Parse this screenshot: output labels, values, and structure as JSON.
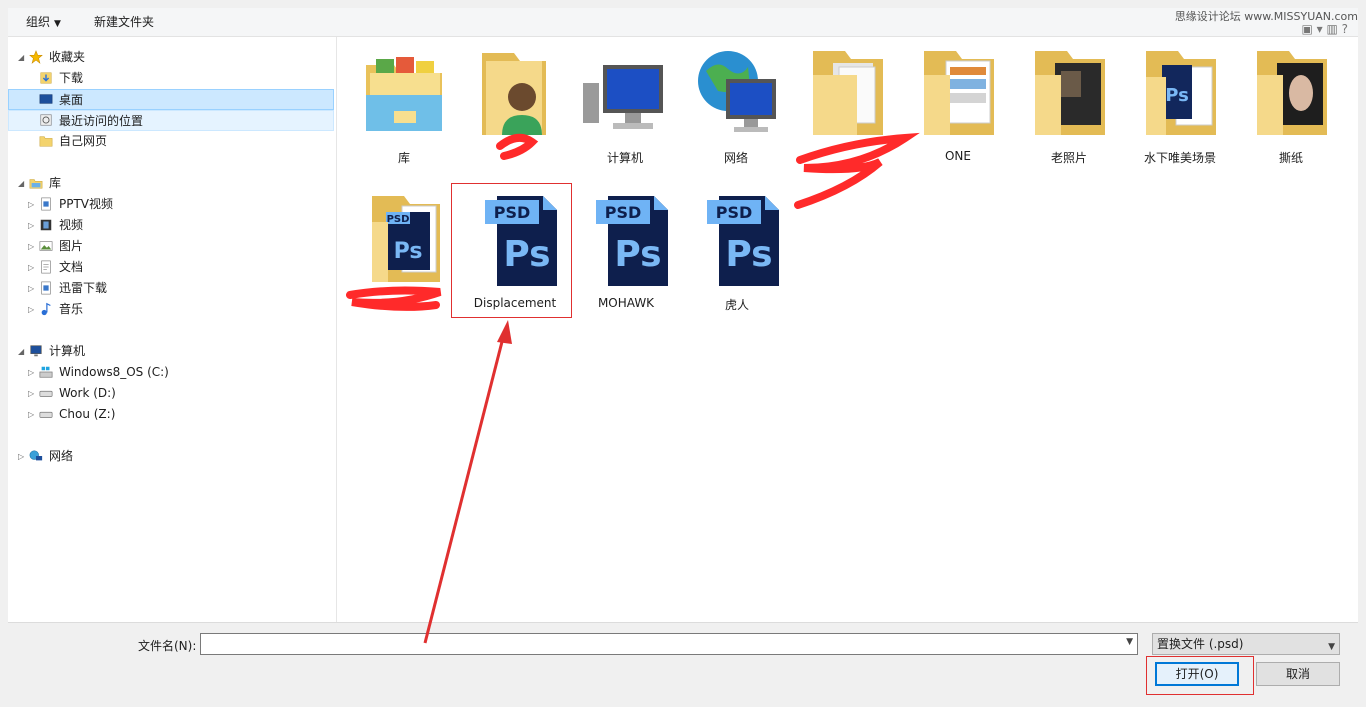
{
  "toolbar": {
    "organize_label": "组织",
    "new_folder_label": "新建文件夹",
    "watermark": "思缘设计论坛 www.MISSYUAN.com"
  },
  "nav": {
    "favorites": {
      "label": "收藏夹",
      "items": [
        "下载",
        "桌面",
        "最近访问的位置",
        "自己网页"
      ]
    },
    "library": {
      "label": "库",
      "items": [
        "PPTV视频",
        "视频",
        "图片",
        "文档",
        "迅雷下载",
        "音乐"
      ]
    },
    "computer": {
      "label": "计算机",
      "items": [
        "Windows8_OS (C:)",
        "Work (D:)",
        "Chou (Z:)"
      ]
    },
    "network": {
      "label": "网络"
    }
  },
  "content": {
    "items": [
      {
        "label": "库",
        "icon": "library-folder-icon"
      },
      {
        "label": "",
        "icon": "user-folder-icon"
      },
      {
        "label": "计算机",
        "icon": "computer-icon"
      },
      {
        "label": "网络",
        "icon": "network-icon"
      },
      {
        "label": "",
        "icon": "folder-icon"
      },
      {
        "label": "ONE",
        "icon": "folder-icon"
      },
      {
        "label": "老照片",
        "icon": "folder-icon"
      },
      {
        "label": "水下唯美场景",
        "icon": "folder-icon"
      },
      {
        "label": "撕纸",
        "icon": "folder-icon"
      },
      {
        "label": "",
        "icon": "psd-folder-icon"
      },
      {
        "label": "Displacement",
        "icon": "psd-file-icon"
      },
      {
        "label": "MOHAWK",
        "icon": "psd-file-icon"
      },
      {
        "label": "虎人",
        "icon": "psd-file-icon"
      }
    ],
    "psd_badge": "PSD",
    "ps_mark": "Ps"
  },
  "bottom": {
    "filename_label": "文件名(N):",
    "filename_value": "",
    "filetype_value": "置换文件 (.psd)",
    "open_label": "打开(O)",
    "cancel_label": "取消"
  },
  "colors": {
    "selection_fill": "#cce8ff",
    "annotation_red": "#e03030",
    "psd_dark": "#0e1f4d",
    "psd_blue": "#6fb3f5"
  }
}
